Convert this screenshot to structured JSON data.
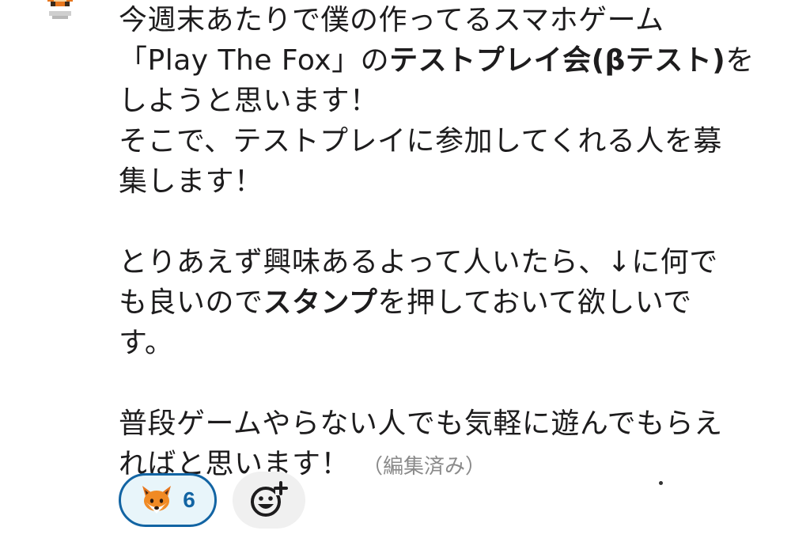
{
  "message": {
    "lines": [
      [
        {
          "text": "今週末あたりで僕の作ってるスマホゲーム",
          "bold": false
        }
      ],
      [
        {
          "text": "「Play The Fox」の",
          "bold": false
        },
        {
          "text": "テストプレイ会(βテスト)",
          "bold": true
        },
        {
          "text": "を",
          "bold": false
        }
      ],
      [
        {
          "text": "しようと思います！",
          "bold": false
        }
      ],
      [
        {
          "text": "そこで、テストプレイに参加してくれる人を募",
          "bold": false
        }
      ],
      [
        {
          "text": "集します！",
          "bold": false
        }
      ],
      [],
      [
        {
          "text": "とりあえず興味あるよって人いたら、↓に何で",
          "bold": false
        }
      ],
      [
        {
          "text": "も良いので",
          "bold": false
        },
        {
          "text": "スタンプ",
          "bold": true
        },
        {
          "text": "を押しておいて欲しいで",
          "bold": false
        }
      ],
      [
        {
          "text": "す。",
          "bold": false
        }
      ],
      [],
      [
        {
          "text": "普段ゲームやらない人でも気軽に遊んでもらえ",
          "bold": false
        }
      ],
      [
        {
          "text": "ればと思います！",
          "bold": false
        }
      ]
    ],
    "edited_label": "（編集済み）"
  },
  "reactions": [
    {
      "emoji": "fox-face-icon",
      "count": "6",
      "active": true
    }
  ],
  "add_reaction": {
    "icon": "add-reaction-icon"
  },
  "colors": {
    "reaction_border": "#1264a3",
    "reaction_bg": "#e8f5fa",
    "text": "#1d1c1d",
    "edited": "#8a8a8a"
  }
}
